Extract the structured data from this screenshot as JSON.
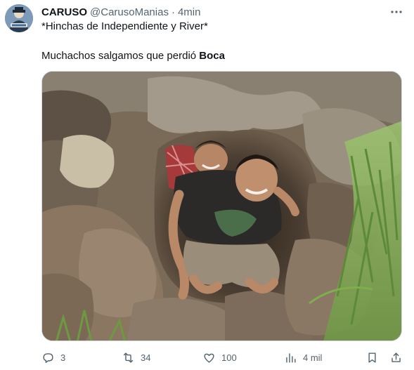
{
  "tweet": {
    "display_name": "CARUSO",
    "handle": "@CarusoManias",
    "separator": "·",
    "time": "4min",
    "more_label": "•••",
    "line1": "*Hinchas de Independiente y River*",
    "line2_prefix": "Muchachos salgamos que perdió ",
    "line2_bold": "Boca",
    "media_alt": "Dos hombres saliendo de una cueva de piedra"
  },
  "actions": {
    "reply_count": "3",
    "retweet_count": "34",
    "like_count": "100",
    "views_count": "4 mil"
  },
  "icons": {
    "reply": "reply-icon",
    "retweet": "retweet-icon",
    "like": "heart-icon",
    "views": "views-icon",
    "bookmark": "bookmark-icon",
    "share": "share-icon"
  },
  "colors": {
    "text": "#0f1419",
    "secondary": "#536471",
    "border": "#cfd9de"
  }
}
